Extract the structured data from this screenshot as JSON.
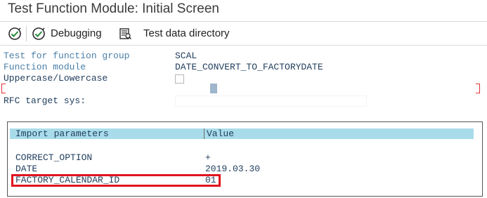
{
  "window": {
    "title": "Test Function Module: Initial Screen"
  },
  "toolbar": {
    "execute_icon": "execute-icon",
    "debug_label": "Debugging",
    "debug_icon": "debug-execute-icon",
    "testdata_label": "Test data directory",
    "testdata_icon": "test-data-directory-icon"
  },
  "form": {
    "function_group_label": "Test for function group",
    "function_group_value": "SCAL",
    "function_module_label": "Function module",
    "function_module_value": "DATE_CONVERT_TO_FACTORYDATE",
    "case_label": "Uppercase/Lowercase",
    "case_checked": false,
    "rfc_label": "RFC target sys:",
    "rfc_value": ""
  },
  "params_table": {
    "headers": [
      "Import parameters",
      "Value"
    ],
    "rows": [
      {
        "name": "CORRECT_OPTION",
        "value": "+"
      },
      {
        "name": "DATE",
        "value": "2019.03.30"
      },
      {
        "name": "FACTORY_CALENDAR_ID",
        "value": "01"
      }
    ]
  },
  "colors": {
    "header_bg": "#a9dcea",
    "label_text": "#4a7fa8",
    "value_text": "#1f3d5c",
    "highlight": "#e0141e"
  }
}
